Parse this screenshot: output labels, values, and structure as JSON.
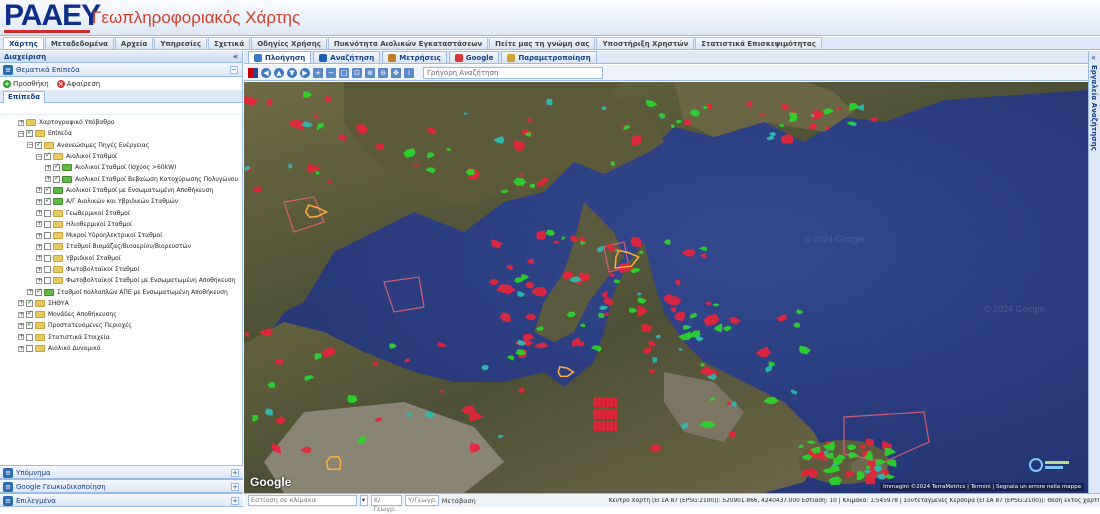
{
  "header": {
    "logo_text": "PAAEY",
    "title": "Γεωπληροφοριακός Χάρτης"
  },
  "main_tabs": [
    {
      "label": "Χάρτης",
      "active": true
    },
    {
      "label": "Μεταδεδομένα"
    },
    {
      "label": "Αρχεία"
    },
    {
      "label": "Υπηρεσίες"
    },
    {
      "label": "Σχετικά"
    },
    {
      "label": "Οδηγίες Χρήσης"
    },
    {
      "label": "Πυκνότητα Αιολικών Εγκαταστάσεων"
    },
    {
      "label": "Πείτε μας τη γνώμη σας"
    },
    {
      "label": "Υποστήριξη Χρηστών"
    },
    {
      "label": "Στατιστικά Επισκεψιμότητας"
    }
  ],
  "left_panel": {
    "title": "Διαχείριση",
    "collapse": "«",
    "thematic_section": "Θεματικά Επίπεδα",
    "add_label": "Προσθήκη",
    "remove_label": "Αφαίρεση",
    "layers_tab": "Επίπεδα",
    "tree": [
      {
        "label": "Χαρτογραφικό Υπόβαθρο",
        "level": 1,
        "checked": null,
        "expander": "+"
      },
      {
        "label": "Επίπεδα",
        "level": 1,
        "checked": true,
        "expander": "−"
      },
      {
        "label": "Ανανεώσιμες Πηγές Ενέργειας",
        "level": 2,
        "checked": true,
        "expander": "−"
      },
      {
        "label": "Αιολικοί Σταθμοί",
        "level": 3,
        "checked": true,
        "expander": "−"
      },
      {
        "label": "Αιολικοί Σταθμοί (Ισχύος >60kW)",
        "level": 4,
        "checked": true,
        "expander": "+",
        "green": true
      },
      {
        "label": "Αιολικοί Σταθμοί Βεβαίωση Κατοχύρωσης Πολυγώνου",
        "level": 4,
        "checked": true,
        "expander": "+",
        "green": true
      },
      {
        "label": "Αιολικοί Σταθμοί με Ενσωματωμένη Αποθήκευση",
        "level": 3,
        "checked": true,
        "expander": "+",
        "green": true
      },
      {
        "label": "Α/Γ Αιολικών και Υβριδικών Σταθμών",
        "level": 3,
        "checked": true,
        "expander": "+",
        "green": true
      },
      {
        "label": "Γεωθερμικοί Σταθμοί",
        "level": 3,
        "checked": false,
        "expander": "+"
      },
      {
        "label": "Ηλιοθερμικοί Σταθμοί",
        "level": 3,
        "checked": false,
        "expander": "+"
      },
      {
        "label": "Μικροί Υδροηλεκτρικοί Σταθμοί",
        "level": 3,
        "checked": false,
        "expander": "+"
      },
      {
        "label": "Σταθμοί Βιομάζας/Βιοαερίου/Βιορευστών",
        "level": 3,
        "checked": false,
        "expander": "+"
      },
      {
        "label": "Υβριδικοί Σταθμοί",
        "level": 3,
        "checked": false,
        "expander": "+"
      },
      {
        "label": "Φωτοβολταϊκοί Σταθμοί",
        "level": 3,
        "checked": false,
        "expander": "+"
      },
      {
        "label": "Φωτοβολταϊκοί Σταθμοί με Ενσωματωμένη Αποθήκευση",
        "level": 3,
        "checked": false,
        "expander": "+"
      },
      {
        "label": "Σταθμοί πολλαπλών ΑΠΕ με Ενσωματωμένη Αποθήκευση",
        "level": 2,
        "checked": true,
        "expander": "+",
        "green": true
      },
      {
        "label": "ΣΗΘΥΑ",
        "level": 1,
        "checked": true,
        "expander": "+"
      },
      {
        "label": "Μονάδες Αποθήκευσης",
        "level": 1,
        "checked": true,
        "expander": "+"
      },
      {
        "label": "Προστατευόμενες Περιοχές",
        "level": 1,
        "checked": true,
        "expander": "+"
      },
      {
        "label": "Στατιστικά Στοιχεία",
        "level": 1,
        "checked": false,
        "expander": "+"
      },
      {
        "label": "Αιολικό Δυναμικό",
        "level": 1,
        "checked": false,
        "expander": "+"
      }
    ],
    "bottom_sections": [
      "Υπόμνημα",
      "Google Γεωκωδικοποίηση",
      "Επιλεγμένα"
    ]
  },
  "map_tabs": [
    {
      "label": "Πλοήγηση",
      "active": true,
      "color": "#3a78c4"
    },
    {
      "label": "Αναζήτηση",
      "color": "#1a5fb4"
    },
    {
      "label": "Μετρήσεις",
      "color": "#c07a20"
    },
    {
      "label": "Google",
      "color": "#d33"
    },
    {
      "label": "Παραμετροποίηση",
      "color": "#d0a030"
    }
  ],
  "map_tools": {
    "icons": [
      "flag-gb-icon",
      "back-icon",
      "up-icon",
      "down-icon",
      "forward-icon",
      "zoom-in-icon",
      "zoom-out-icon",
      "zoom-box-icon",
      "zoom-extent-icon",
      "zoom-in-area-icon",
      "zoom-out-area-icon",
      "pan-icon",
      "info-icon"
    ],
    "quick_search_placeholder": "Γρήγορη Αναζήτηση"
  },
  "map": {
    "credits": "Immagini ©2024 TerraMetrics | Termini | Segnala un errore nella mappa",
    "google_logo": "Google",
    "watermark_text": "© 2024 Google",
    "colors": {
      "sea": "#2a3d86",
      "land": "#5a5a3c",
      "wind_red": "#e8243c",
      "wind_green": "#2bd62b",
      "cyan": "#2fb8b0",
      "orange": "#ff9a20"
    }
  },
  "status_bar": {
    "geocode_placeholder": "Εστίαση σε κλίμακα",
    "x_label": "Χ/Γεωγρ.",
    "y_label": "Υ/Γεωγρ.",
    "go_label": "Μετάβαση",
    "coords_text": "Κέντρο Χάρτη (ΕΓΣΑ 87 (EPSG:2100)): 520901.866, 4240437.000 Εστίαση: 10 | Κλίμακα: 1:545978 | Συντεταγμένες Κέρσορα (ΕΓΣΑ 87 (EPSG:2100)): Θέση εκτός χάρτη..."
  },
  "right_strip": {
    "label": "Εργαλεία Αναζήτησης",
    "arrow": "«"
  }
}
